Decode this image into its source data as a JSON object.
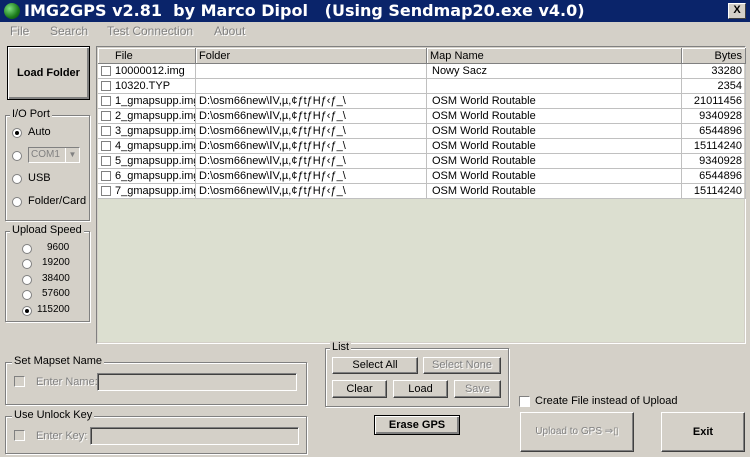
{
  "window": {
    "title": "IMG2GPS v2.81  by Marco Dipol   (Using Sendmap20.exe v4.0)",
    "close_glyph": "X"
  },
  "menu": {
    "items": [
      "File",
      "Search",
      "Test Connection",
      "About"
    ]
  },
  "load_folder": {
    "label": "Load Folder"
  },
  "io_port": {
    "legend": "I/O Port",
    "auto": "Auto",
    "com_value": "COM1",
    "usb": "USB",
    "folder_card": "Folder/Card",
    "selected": "Auto"
  },
  "upload_speed": {
    "legend": "Upload Speed",
    "options": [
      "9600",
      "19200",
      "38400",
      "57600",
      "115200"
    ],
    "selected": "115200"
  },
  "table": {
    "headers": {
      "file": "File",
      "folder": "Folder",
      "map": "Map Name",
      "bytes": "Bytes"
    },
    "rows": [
      {
        "file": "10000012.img",
        "folder": "",
        "map": "Nowy Sacz",
        "bytes": "33280"
      },
      {
        "file": "10320.TYP",
        "folder": "",
        "map": "",
        "bytes": "2354"
      },
      {
        "file": "1_gmapsupp.img",
        "folder": "D:\\osm66new\\ⅠV,µ,¢ƒtƒHƒ‹ƒ_\\",
        "map": "OSM World Routable",
        "bytes": "21011456"
      },
      {
        "file": "2_gmapsupp.img",
        "folder": "D:\\osm66new\\ⅠV,µ,¢ƒtƒHƒ‹ƒ_\\",
        "map": "OSM World Routable",
        "bytes": "9340928"
      },
      {
        "file": "3_gmapsupp.img",
        "folder": "D:\\osm66new\\ⅠV,µ,¢ƒtƒHƒ‹ƒ_\\",
        "map": "OSM World Routable",
        "bytes": "6544896"
      },
      {
        "file": "4_gmapsupp.img",
        "folder": "D:\\osm66new\\ⅠV,µ,¢ƒtƒHƒ‹ƒ_\\",
        "map": "OSM World Routable",
        "bytes": "15114240"
      },
      {
        "file": "5_gmapsupp.img",
        "folder": "D:\\osm66new\\ⅠV,µ,¢ƒtƒHƒ‹ƒ_\\",
        "map": "OSM World Routable",
        "bytes": "9340928"
      },
      {
        "file": "6_gmapsupp.img",
        "folder": "D:\\osm66new\\ⅠV,µ,¢ƒtƒHƒ‹ƒ_\\",
        "map": "OSM World Routable",
        "bytes": "6544896"
      },
      {
        "file": "7_gmapsupp.img",
        "folder": "D:\\osm66new\\ⅠV,µ,¢ƒtƒHƒ‹ƒ_\\",
        "map": "OSM World Routable",
        "bytes": "15114240"
      }
    ]
  },
  "mapset": {
    "legend": "Set Mapset Name",
    "field_label": "Enter Name:",
    "value": ""
  },
  "unlock": {
    "legend": "Use Unlock Key",
    "field_label": "Enter Key:",
    "value": ""
  },
  "list": {
    "legend": "List",
    "select_all": "Select All",
    "select_none": "Select None",
    "clear": "Clear",
    "load": "Load",
    "save": "Save"
  },
  "erase_gps": {
    "label": "Erase GPS"
  },
  "create_file": {
    "label": "Create File instead of Upload",
    "checked": false
  },
  "upload": {
    "label": "Upload to GPS"
  },
  "exit": {
    "label": "Exit"
  },
  "colors": {
    "titlebar": "#0a246a",
    "face": "#d4d0c8",
    "list_bg": "#dcdfd0"
  }
}
